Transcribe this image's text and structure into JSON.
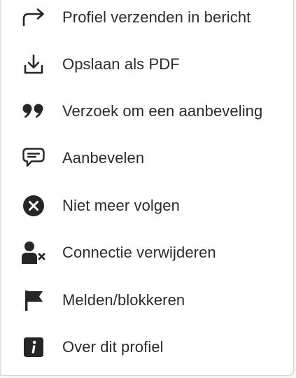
{
  "menu": {
    "items": [
      {
        "label": "Profiel verzenden in bericht",
        "icon": "share-arrow-icon"
      },
      {
        "label": "Opslaan als PDF",
        "icon": "download-icon"
      },
      {
        "label": "Verzoek om een aanbeveling",
        "icon": "quote-icon"
      },
      {
        "label": "Aanbevelen",
        "icon": "speech-bubble-icon"
      },
      {
        "label": "Niet meer volgen",
        "icon": "close-circle-icon"
      },
      {
        "label": "Connectie verwijderen",
        "icon": "remove-person-icon"
      },
      {
        "label": "Melden/blokkeren",
        "icon": "flag-icon"
      },
      {
        "label": "Over dit profiel",
        "icon": "info-icon"
      }
    ]
  },
  "colors": {
    "icon": "#262626",
    "text": "#2b2b2b",
    "background": "#ffffff"
  }
}
